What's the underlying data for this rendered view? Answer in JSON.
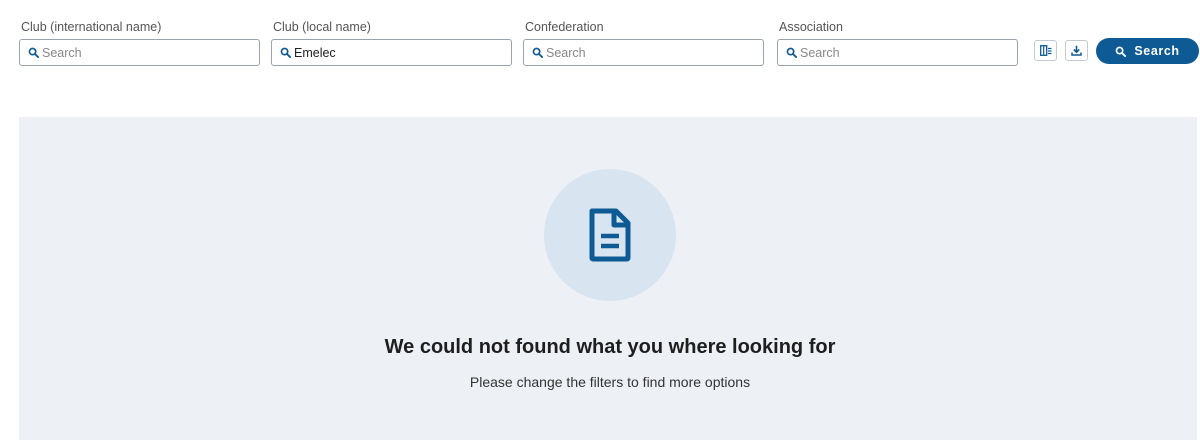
{
  "filters": [
    {
      "label": "Club (international name)",
      "value": "",
      "placeholder": "Search"
    },
    {
      "label": "Club (local name)",
      "value": "Emelec",
      "placeholder": "Search"
    },
    {
      "label": "Confederation",
      "value": "",
      "placeholder": "Search"
    },
    {
      "label": "Association",
      "value": "",
      "placeholder": "Search"
    }
  ],
  "actions": {
    "columns_icon": "columns-icon",
    "download_icon": "download-icon",
    "search_label": "Search"
  },
  "empty_state": {
    "icon": "document-icon",
    "title": "We could not found what you where looking for",
    "subtitle": "Please change the filters to find more options"
  },
  "colors": {
    "primary": "#0e5a94",
    "panel_bg": "#edf1f6",
    "circle_bg": "#d8e4f0"
  }
}
